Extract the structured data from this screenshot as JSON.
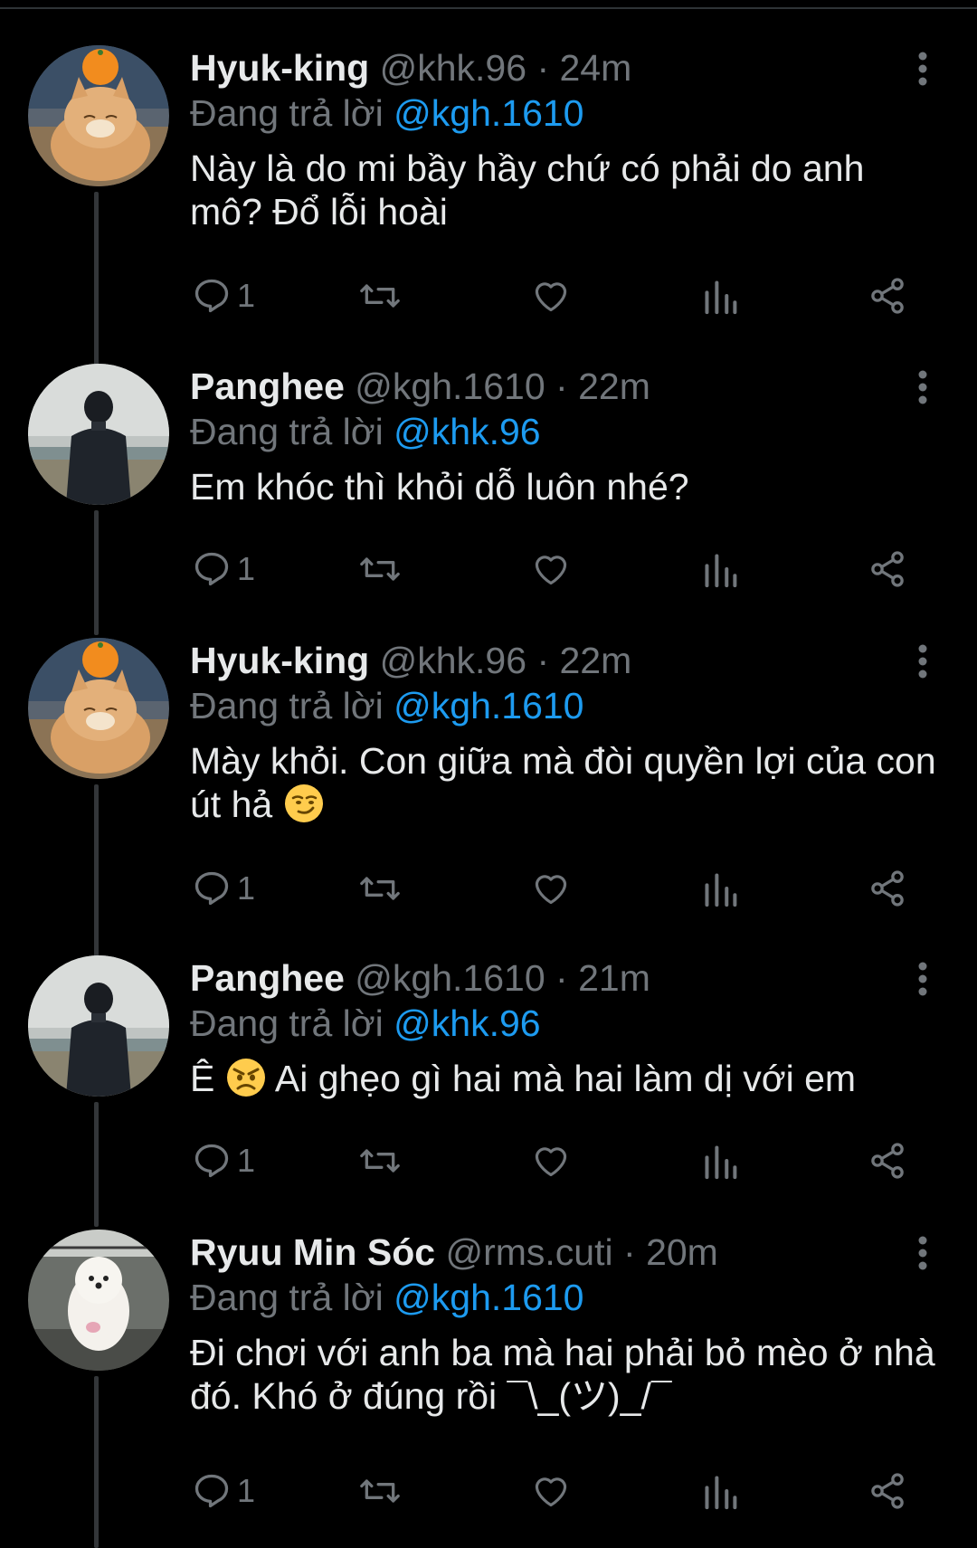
{
  "colors": {
    "background": "#000000",
    "text": "#e7e9ea",
    "muted": "#71767b",
    "accent": "#1d9bf0",
    "thread_line": "#333639"
  },
  "tweets": [
    {
      "name": "Hyuk-king",
      "handle": "@khk.96",
      "dot": "·",
      "time": "24m",
      "reply_label": "Đang trả lời",
      "reply_to": "@kgh.1610",
      "text": "Này là do mi bầy hầy chứ có phải do anh mô? Đổ lỗi hoài",
      "emoji": "",
      "text_after": "",
      "reply_count": "1",
      "avatar": "cat-with-orange"
    },
    {
      "name": "Panghee",
      "handle": "@kgh.1610",
      "dot": "·",
      "time": "22m",
      "reply_label": "Đang trả lời",
      "reply_to": "@khk.96",
      "text": "Em khóc thì khỏi dỗ luôn nhé?",
      "emoji": "",
      "text_after": "",
      "reply_count": "1",
      "avatar": "person-in-black-jacket"
    },
    {
      "name": "Hyuk-king",
      "handle": "@khk.96",
      "dot": "·",
      "time": "22m",
      "reply_label": "Đang trả lời",
      "reply_to": "@kgh.1610",
      "text": "Mày khỏi. Con giữa mà đòi quyền lợi của con út hả ",
      "emoji": "smirk-emoji",
      "text_after": "",
      "reply_count": "1",
      "avatar": "cat-with-orange"
    },
    {
      "name": "Panghee",
      "handle": "@kgh.1610",
      "dot": "·",
      "time": "21m",
      "reply_label": "Đang trả lời",
      "reply_to": "@khk.96",
      "text": "Ê ",
      "emoji": "angry-emoji",
      "text_after": " Ai ghẹo gì hai mà hai làm dị với em",
      "reply_count": "1",
      "avatar": "person-in-black-jacket"
    },
    {
      "name": "Ryuu Min Sóc",
      "handle": "@rms.cuti",
      "dot": "·",
      "time": "20m",
      "reply_label": "Đang trả lời",
      "reply_to": "@kgh.1610",
      "text": "Đi chơi với anh ba mà hai phải bỏ mèo ở nhà đó. Khó ở đúng rồi ¯\\_(ツ)_/¯",
      "emoji": "",
      "text_after": "",
      "reply_count": "1",
      "avatar": "white-fluffy-dog"
    }
  ]
}
